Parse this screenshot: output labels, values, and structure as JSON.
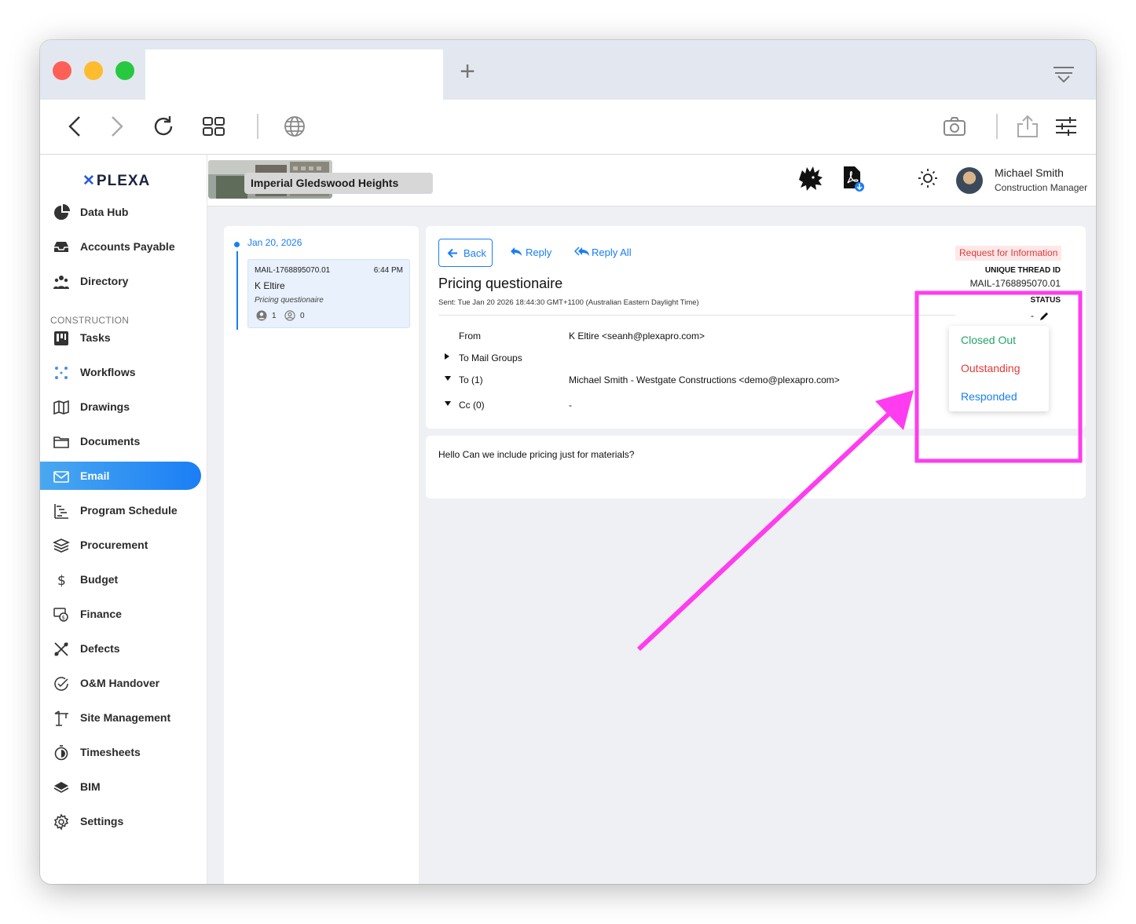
{
  "browser": {
    "tab_title": "",
    "new_tab_icon": "plus-icon",
    "toolbar_icons": [
      "back-arrow-icon",
      "forward-arrow-icon",
      "reload-icon",
      "tabs-grid-icon",
      "globe-icon",
      "camera-icon",
      "share-icon",
      "sliders-icon"
    ]
  },
  "sidebar": {
    "logo": "PLEXA",
    "section_label": "CONSTRUCTION",
    "items": [
      {
        "label": "Data Hub",
        "icon": "pie-chart-icon"
      },
      {
        "label": "Accounts Payable",
        "icon": "inbox-tray-icon"
      },
      {
        "label": "Directory",
        "icon": "people-icon"
      },
      {
        "label": "Tasks",
        "icon": "kanban-icon"
      },
      {
        "label": "Workflows",
        "icon": "workflow-icon"
      },
      {
        "label": "Drawings",
        "icon": "map-icon"
      },
      {
        "label": "Documents",
        "icon": "folder-icon"
      },
      {
        "label": "Email",
        "icon": "envelope-icon"
      },
      {
        "label": "Program Schedule",
        "icon": "gantt-icon"
      },
      {
        "label": "Procurement",
        "icon": "layers-icon"
      },
      {
        "label": "Budget",
        "icon": "dollar-icon"
      },
      {
        "label": "Finance",
        "icon": "finance-icon"
      },
      {
        "label": "Defects",
        "icon": "tools-icon"
      },
      {
        "label": "O&M Handover",
        "icon": "check-circle-icon"
      },
      {
        "label": "Site Management",
        "icon": "crane-icon"
      },
      {
        "label": "Timesheets",
        "icon": "stopwatch-icon"
      },
      {
        "label": "BIM",
        "icon": "bim-icon"
      },
      {
        "label": "Settings",
        "icon": "gear-icon"
      }
    ],
    "active": "Email"
  },
  "topbar": {
    "project_name": "Imperial Gledswood Heights",
    "user_name": "Michael Smith",
    "user_role": "Construction Manager"
  },
  "thread_list": {
    "date": "Jan 20, 2026",
    "card": {
      "id": "MAIL-1768895070.01",
      "time": "6:44 PM",
      "from": "K Eltire",
      "subject": "Pricing questionaire",
      "count_a": "1",
      "count_b": "0"
    }
  },
  "detail": {
    "back_label": "Back",
    "reply_label": "Reply",
    "reply_all_label": "Reply All",
    "badge": "Request for Information",
    "thread_id_label": "UNIQUE THREAD ID",
    "thread_id": "MAIL-1768895070.01",
    "status_label": "STATUS",
    "status_value": "-",
    "subject": "Pricing questionaire",
    "sent": "Sent: Tue Jan 20 2026 18:44:30 GMT+1100 (Australian Eastern Daylight Time)",
    "from_label": "From",
    "from_name": "K Eltire",
    "from_email": "<seanh@plexapro.com>",
    "to_groups_label": "To Mail Groups",
    "to_label": "To (1)",
    "to_name": "Michael Smith",
    "to_rest": " - Westgate Constructions <demo@plexapro.com>",
    "cc_label": "Cc (0)",
    "cc_value": "-",
    "status_options": [
      {
        "label": "Closed Out",
        "color": "#22a56a"
      },
      {
        "label": "Outstanding",
        "color": "#e53935"
      },
      {
        "label": "Responded",
        "color": "#1a7ef5"
      }
    ],
    "body": "Hello Can we include pricing just for materials?"
  },
  "colors": {
    "accent": "#1a7ef5",
    "annotation": "#ff3cf0"
  }
}
